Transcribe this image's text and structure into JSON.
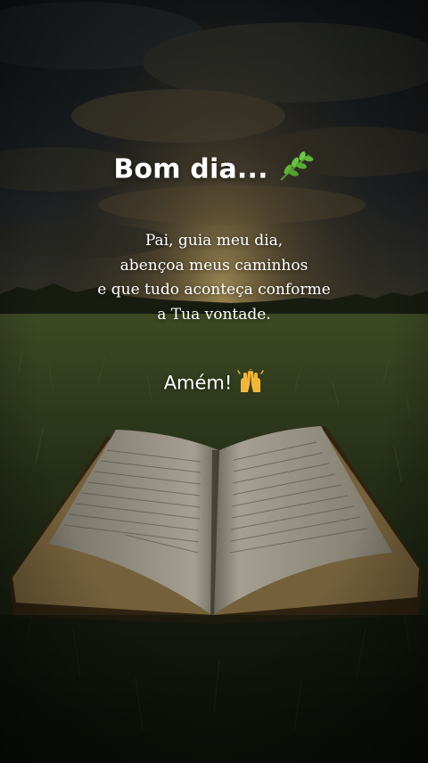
{
  "greeting": {
    "text": "Bom dia...",
    "emoji_icon": "herb-icon"
  },
  "prayer": {
    "lines": [
      "Pai, guia meu dia,",
      "abençoa meus caminhos",
      "e que tudo aconteça conforme",
      "a Tua vontade."
    ]
  },
  "closing": {
    "text": "Amém!",
    "emoji_icon": "raising-hands-icon"
  },
  "colors": {
    "text": "#ffffff",
    "sky_dark": "#1e2228",
    "sunset_glow": "#c9a45a",
    "grass": "#3a4a24"
  }
}
